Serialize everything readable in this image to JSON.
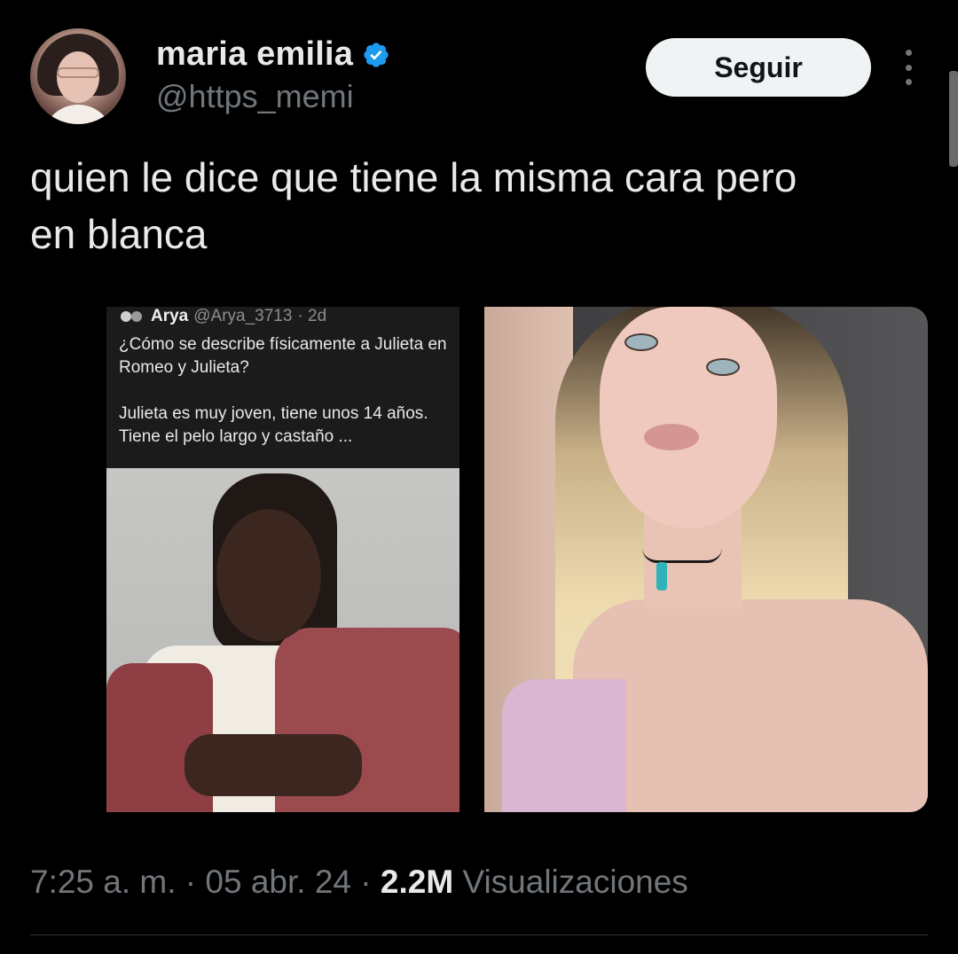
{
  "author": {
    "display_name": "maria emilia",
    "handle": "@https_memi",
    "verified": true
  },
  "actions": {
    "follow_label": "Seguir"
  },
  "tweet": {
    "text": "quien le dice que tiene la misma cara pero\nen blanca"
  },
  "embedded_post": {
    "name": "Arya",
    "handle": "@Arya_3713",
    "age": "· 2d",
    "question": "¿Cómo se describe físicamente a Julieta en Romeo y Julieta?",
    "answer": "Julieta es muy joven, tiene unos 14 años. Tiene el pelo largo y castaño ..."
  },
  "meta": {
    "time": "7:25 a. m.",
    "sep1": " · ",
    "date": "05 abr. 24",
    "sep2": " · ",
    "views_count": "2.2M",
    "views_label": " Visualizaciones"
  },
  "colors": {
    "background": "#000000",
    "text": "#e7e9ea",
    "muted": "#71767b",
    "verified": "#1d9bf0",
    "button_bg": "#eff3f4"
  }
}
